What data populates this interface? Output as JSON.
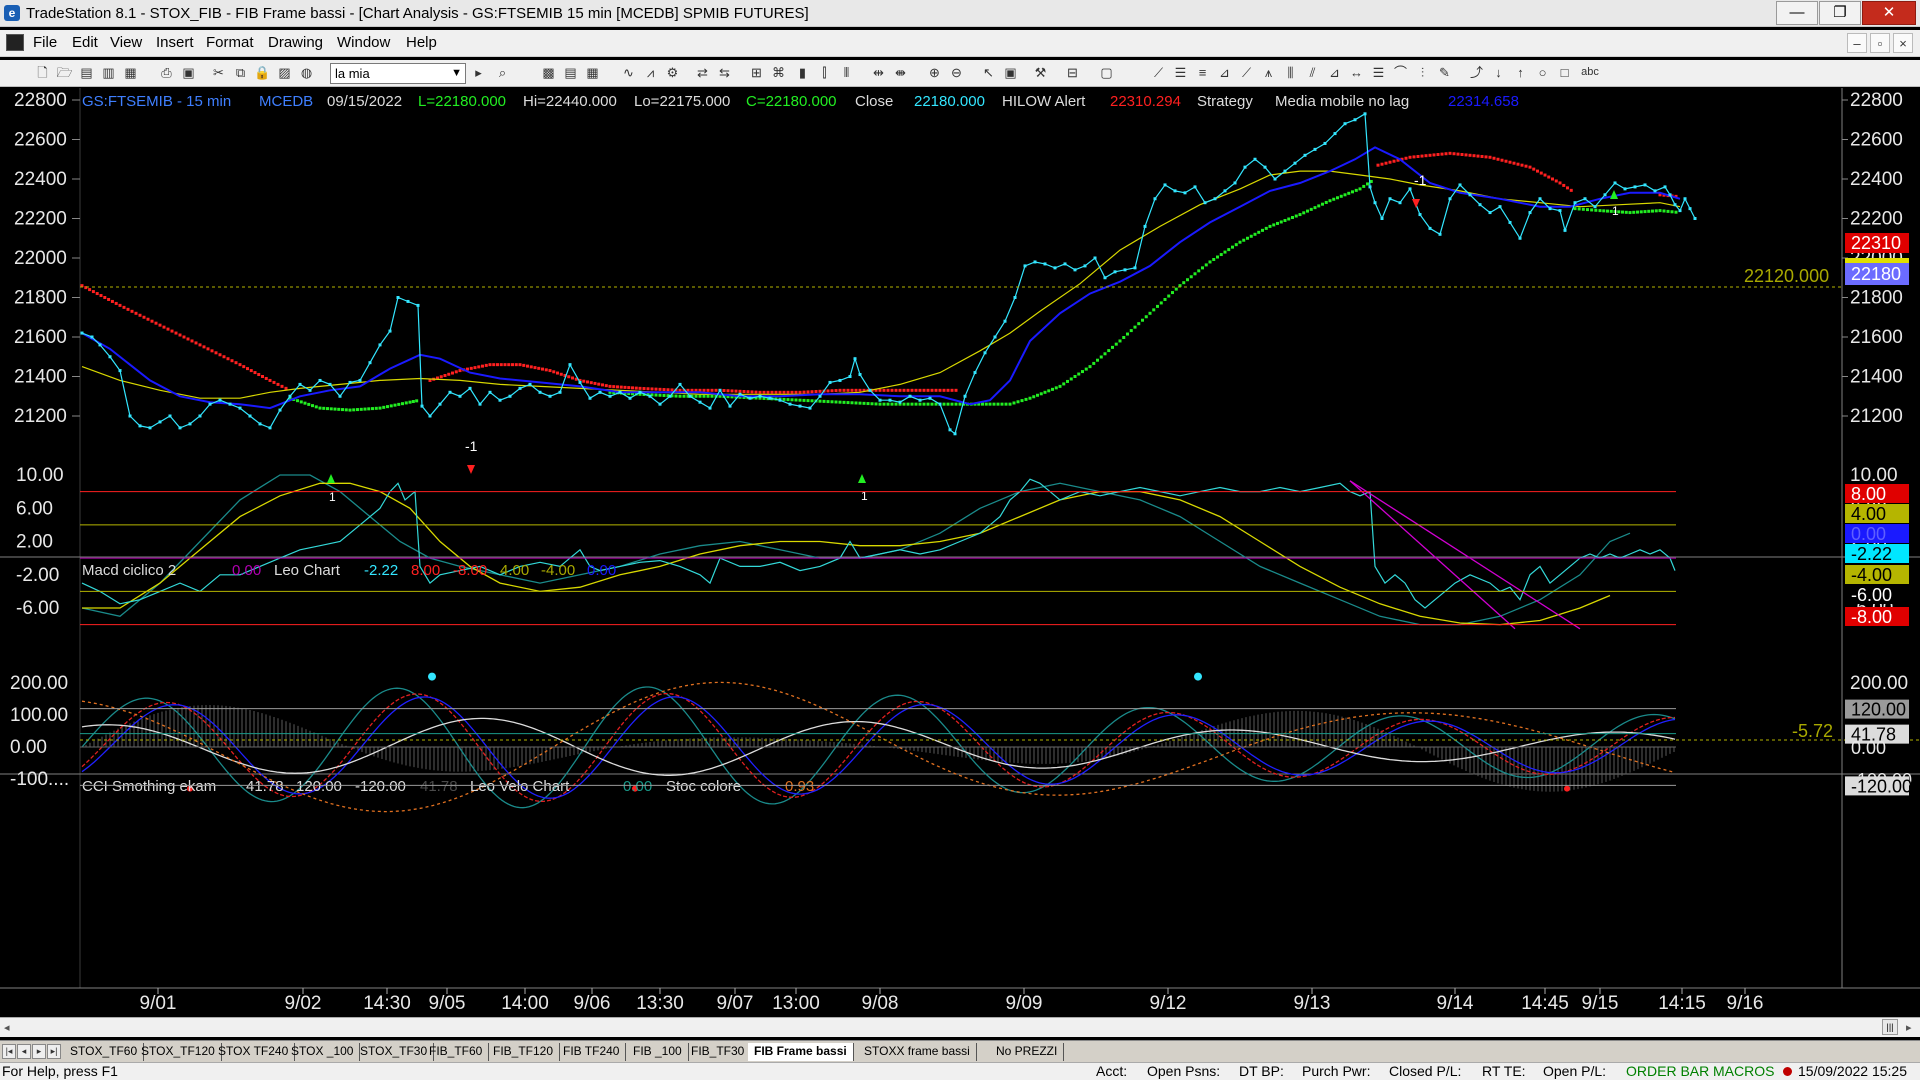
{
  "window": {
    "title": "TradeStation 8.1 - STOX_FIB - FIB Frame bassi - [Chart Analysis - GS:FTSEMIB  15 min  [MCEDB] SPMIB FUTURES]",
    "controls": {
      "minimize": "—",
      "restore": "❐",
      "close": "✕"
    }
  },
  "menu": {
    "items": [
      "File",
      "Edit",
      "View",
      "Insert",
      "Format",
      "Drawing",
      "Window",
      "Help"
    ],
    "mdi": {
      "minimize": "–",
      "restore": "▫",
      "close": "×"
    }
  },
  "toolbar": {
    "workspace_select": "la mia",
    "text_tool": "abc"
  },
  "colors": {
    "price": "#33e6ff",
    "ma_blue": "#1a1aff",
    "ma_yellow": "#d8d800",
    "dots_red": "#ff2020",
    "dots_green": "#22ee22",
    "background": "#000000"
  },
  "price_panel": {
    "header": {
      "symbol": "GS:FTSEMIB - 15 min",
      "source": "MCEDB",
      "date": "09/15/2022",
      "last": "L=22180.000",
      "high": "Hi=22440.000",
      "low": "Lo=22175.000",
      "close_value": "C=22180.000",
      "close_label": "Close",
      "close_num": "22180.000",
      "hilow_label": "HILOW Alert",
      "hilow_value": "22310.294",
      "strategy_label": "Strategy",
      "media_label": "Media mobile no lag",
      "media_value": "22314.658"
    },
    "y_ticks": [
      "22800",
      "22600",
      "22400",
      "22200",
      "22000",
      "21800",
      "21600",
      "21400",
      "21200"
    ],
    "ref_line_label": "22120.000",
    "price_tags": [
      "22310",
      "22180"
    ],
    "markers": [
      "1",
      "-1",
      "1",
      "1",
      "-1",
      "1",
      "-1",
      "1"
    ]
  },
  "macd_panel": {
    "header": {
      "name": "Macd ciclico 2",
      "v0": "0.00",
      "leo_label": "Leo Chart",
      "v1": "-2.22",
      "v2": "8.00",
      "v3": "-8.00",
      "v4": "4.00",
      "v5": "-4.00",
      "v6": "0.00"
    },
    "y_ticks": [
      "10.00",
      "6.00",
      "2.00",
      "-2.00",
      "-6.00"
    ],
    "level_tags": [
      "8.00",
      "4.00",
      "0.00",
      "-2.22",
      "-4.00",
      "-6.00",
      "-8.00"
    ],
    "ref_line_label": "-5.72"
  },
  "cci_panel": {
    "header": {
      "name": "CCI Smothing ekam",
      "v0": "41.78",
      "v1": "120.00",
      "v2": "-120.00",
      "v3": "41.78",
      "velo_label": "Leo Velo Chart",
      "velo_value": "0.00",
      "stoc_label": "Stoc colore",
      "stoc_value": "0.93"
    },
    "y_ticks": [
      "200.00",
      "100.00",
      "0.00",
      "-100...."
    ],
    "level_tags": [
      "120.00",
      "41.78",
      "0.00",
      "-100.00",
      "-120.00"
    ]
  },
  "time_axis": [
    "9/01",
    "9/02",
    "14:30",
    "9/05",
    "14:00",
    "9/06",
    "13:30",
    "9/07",
    "13:00",
    "9/08",
    "9/09",
    "9/12",
    "9/13",
    "9/14",
    "14:45",
    "9/15",
    "14:15",
    "9/16"
  ],
  "tabs": {
    "items": [
      "STOX_TF60",
      "STOX_TF120",
      "STOX TF240",
      "STOX _100",
      "STOX_TF30",
      "FIB_TF60",
      "FIB_TF120",
      "FIB TF240",
      "FIB _100",
      "FIB_TF30",
      "FIB Frame bassi",
      "STOXX frame bassi",
      "No PREZZI"
    ],
    "active_index": 10
  },
  "status": {
    "help": "For Help, press F1",
    "acct": "Acct:",
    "open_psns": "Open Psns:",
    "dt_bp": "DT BP:",
    "purch_pwr": "Purch Pwr:",
    "closed_pl": "Closed P/L:",
    "rt_te": "RT TE:",
    "open_pl": "Open P/L:",
    "order_bar": "ORDER BAR",
    "macros": "MACROS",
    "datetime": "15/09/2022 15:25"
  }
}
